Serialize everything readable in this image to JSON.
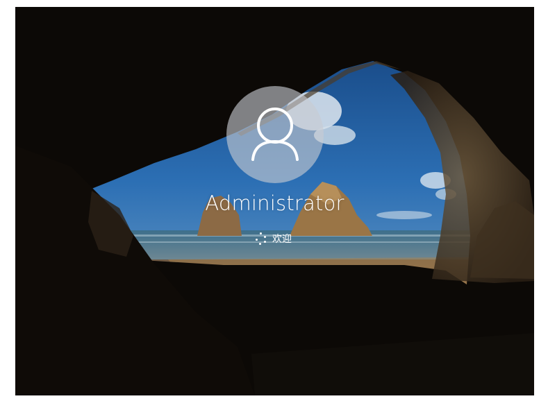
{
  "login": {
    "username": "Administrator",
    "status_text": "欢迎"
  },
  "icons": {
    "avatar": "user-silhouette-icon",
    "spinner": "loading-spinner-icon"
  },
  "colors": {
    "text": "#ffffff",
    "avatar_bg": "#c8ccd2",
    "sky": "#2f6fb3",
    "sand": "#8a6a40",
    "cave": "#0a0806"
  }
}
